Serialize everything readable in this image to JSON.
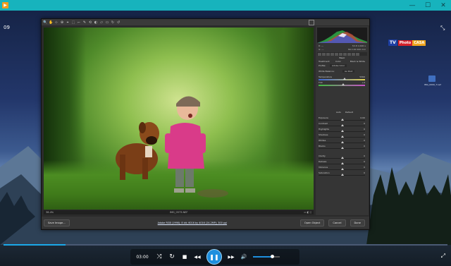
{
  "window": {
    "minimize": "—",
    "maximize": "☐",
    "close": "✕"
  },
  "overlay": {
    "episode": "09",
    "episode_sub": "",
    "desktop_icon_label": "IMG_0000_T.nef",
    "logo": {
      "tv": "TV",
      "photo": "Photo",
      "casa": "CASA"
    }
  },
  "camera_raw": {
    "tools": [
      "🔍",
      "✋",
      "⊹",
      "⊕",
      "⌖",
      "⬚",
      "⌐",
      "✎",
      "⟲",
      "◐",
      "▱",
      "▭",
      "↻",
      "↺"
    ],
    "panel": {
      "readout_left": [
        "R: ---",
        "G: ---",
        "B: ---"
      ],
      "readout_right": [
        "f/2.8   1/400 s",
        "ISO 100   200 mm"
      ],
      "section_title": "Basic",
      "treatment_label": "Treatment:",
      "treatment_color": "Color",
      "treatment_bw": "Black & White",
      "profile_label": "Profile:",
      "profile_value": "Adobe Color",
      "wb_label": "White Balance:",
      "wb_value": "As Shot",
      "auto": "Auto",
      "default": "Default",
      "sliders": [
        {
          "label": "Temperature",
          "value": "5300",
          "pos": 0.55
        },
        {
          "label": "Tint",
          "value": "+4",
          "pos": 0.52
        },
        {
          "label": "Exposure",
          "value": "0.00",
          "pos": 0.5
        },
        {
          "label": "Contrast",
          "value": "0",
          "pos": 0.5
        },
        {
          "label": "Highlights",
          "value": "0",
          "pos": 0.5
        },
        {
          "label": "Shadows",
          "value": "0",
          "pos": 0.5
        },
        {
          "label": "Whites",
          "value": "0",
          "pos": 0.5
        },
        {
          "label": "Blacks",
          "value": "0",
          "pos": 0.5
        },
        {
          "label": "Clarity",
          "value": "0",
          "pos": 0.5
        },
        {
          "label": "Dehaze",
          "value": "0",
          "pos": 0.5
        },
        {
          "label": "Vibrance",
          "value": "0",
          "pos": 0.5
        },
        {
          "label": "Saturation",
          "value": "0",
          "pos": 0.5
        }
      ]
    },
    "status": {
      "zoom": "38.4%",
      "filename": "IMG_0573.NEF"
    },
    "bottom": {
      "save": "Save Image...",
      "info": "Adobe RGB (1998); 8 bit; 6016 by 4016 (24.2MP); 300 ppi",
      "open": "Open Object",
      "cancel": "Cancel",
      "done": "Done"
    }
  },
  "player": {
    "time": "03:00",
    "progress": 0.14,
    "volume": 0.72,
    "buttons": {
      "shuffle": "⤨",
      "repeat": "↻",
      "stop": "■",
      "prev": "◀◀",
      "play": "▶",
      "next": "▶▶",
      "volume": "🔊"
    }
  }
}
